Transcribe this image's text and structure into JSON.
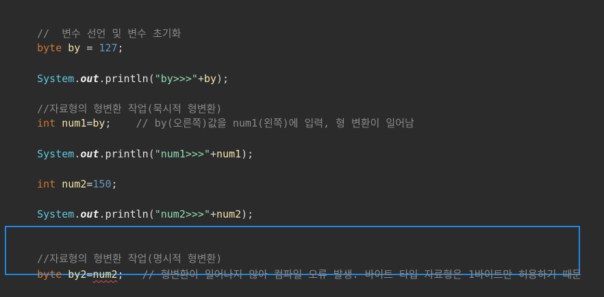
{
  "code": {
    "line1": {
      "comment": "//  변수 선언 및 변수 초기화"
    },
    "line2": {
      "kw": "byte",
      "name": "by",
      "eq": " = ",
      "value": "127",
      "semi": ";"
    },
    "line3": {
      "cls": "System",
      "dot1": ".",
      "field": "out",
      "dot2": ".",
      "method": "println",
      "open": "(",
      "str": "\"by>>>\"",
      "plus": "+",
      "arg": "by",
      "close": ");"
    },
    "line4": {
      "comment": "//자료형의 형변환 작업(묵시적 형변환)"
    },
    "line5": {
      "kw": "int",
      "name": "num1",
      "eq": "=",
      "value": "by",
      "semi": ";",
      "comment": "// by(오른쪽)값을 num1(왼쪽)에 입력, 형 변환이 일어남"
    },
    "line6": {
      "cls": "System",
      "dot1": ".",
      "field": "out",
      "dot2": ".",
      "method": "println",
      "open": "(",
      "str": "\"num1>>>\"",
      "plus": "+",
      "arg": "num1",
      "close": ");"
    },
    "line7": {
      "kw": "int",
      "name": "num2",
      "eq": "=",
      "value": "150",
      "semi": ";"
    },
    "line8": {
      "cls": "System",
      "dot1": ".",
      "field": "out",
      "dot2": ".",
      "method": "println",
      "open": "(",
      "str": "\"num2>>>\"",
      "plus": "+",
      "arg": "num2",
      "close": ");"
    },
    "line9": {
      "comment": "//자료형의 형변환 작업(명시적 형변환)"
    },
    "line10": {
      "kw": "byte",
      "name": "by2",
      "eq": "=",
      "value": "num2",
      "semi": ";",
      "comment": "// 형변환이 일어나지 않아 컴파일 오류 발생. 바이트 타입 자료형은 1바이트만 허용하기 때문"
    }
  },
  "colors": {
    "background": "#2b2b2b",
    "keyword": "#cc7832",
    "variable": "#f2e5a7",
    "number": "#6897bb",
    "type": "#5ec9e0",
    "string": "#90ddb0",
    "comment": "#8a8a8a",
    "highlight_border": "#1e88e5",
    "error_squiggle": "#e05050"
  }
}
